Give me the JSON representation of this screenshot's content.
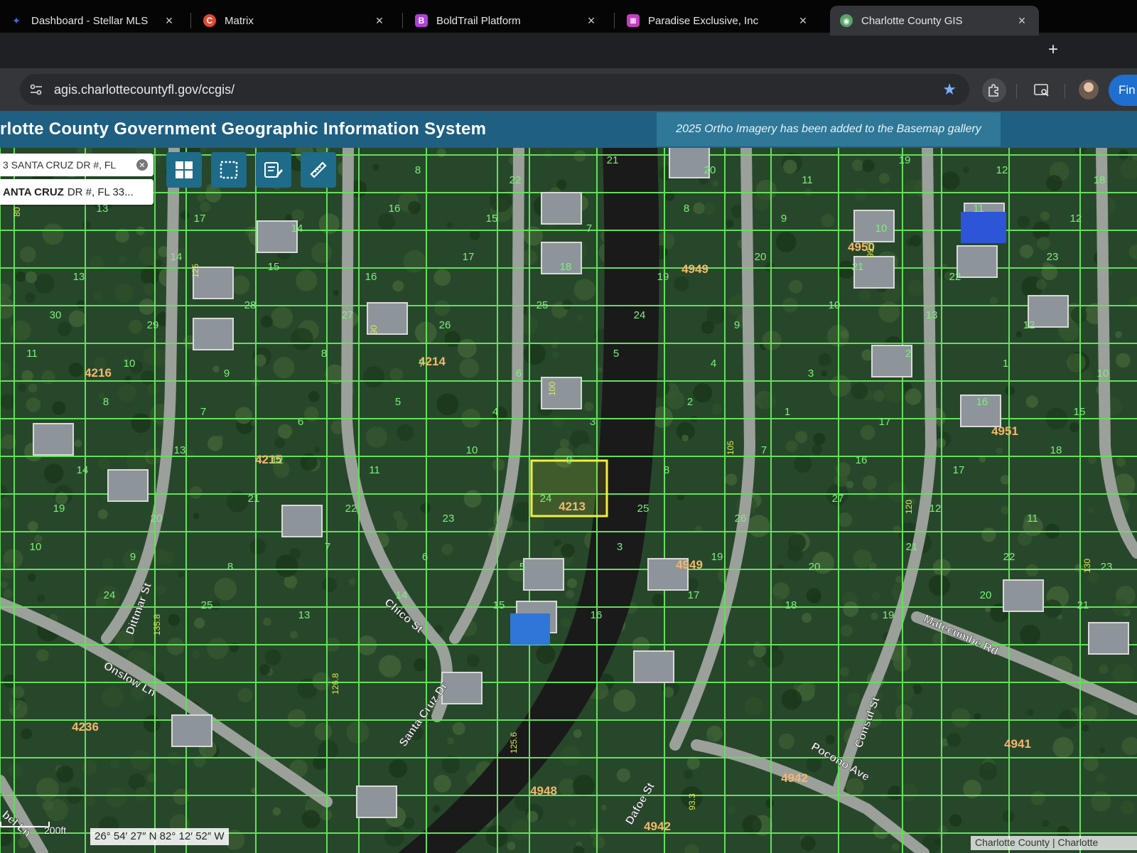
{
  "browser": {
    "tabs": [
      {
        "title": "Dashboard - Stellar MLS",
        "favicon_color": "#3a6fd8"
      },
      {
        "title": "Matrix",
        "favicon_color": "#e0492f"
      },
      {
        "title": "BoldTrail Platform",
        "favicon_color": "#b13fd6"
      },
      {
        "title": "Paradise Exclusive, Inc",
        "favicon_color": "#c23fbf"
      },
      {
        "title": "Charlotte County GIS",
        "favicon_color": "#5aa36b"
      }
    ],
    "favicon_letters": {
      "matrix": "C",
      "boldtrail": "B"
    },
    "close_glyph": "×",
    "new_tab_glyph": "+",
    "url": "agis.charlottecountyfl.gov/ccgis/",
    "find_label": "Fin"
  },
  "gis": {
    "title": "rlotte County Government Geographic Information System",
    "banner": "2025 Ortho Imagery has been added to the Basemap gallery",
    "search_value": "3 SANTA CRUZ DR #, FL",
    "suggestion_bold": "ANTA CRUZ",
    "suggestion_rest": "DR #, FL 33...",
    "tools": [
      "grid-tool",
      "select-tool",
      "notes-tool",
      "measure-tool"
    ]
  },
  "map": {
    "street_labels": [
      {
        "text": "Dittmar St"
      },
      {
        "text": "Onslow Ln"
      },
      {
        "text": "Chico St"
      },
      {
        "text": "Santa Cruz Dr"
      },
      {
        "text": "Dafoe St"
      },
      {
        "text": "Pocono Ave"
      },
      {
        "text": "Consul St"
      },
      {
        "text": "Matecumbe Rd"
      },
      {
        "text": "bel Ln"
      }
    ],
    "block_numbers": [
      "4216",
      "4214",
      "4215",
      "4213",
      "4236",
      "4949",
      "4950",
      "4951",
      "4948",
      "4942",
      "4941",
      "4949",
      "4942"
    ],
    "lot_numbers": [
      "6",
      "24",
      "7",
      "23",
      "8",
      "22",
      "21",
      "20",
      "11",
      "19",
      "12",
      "18",
      "13",
      "17",
      "14",
      "16",
      "15",
      "7",
      "8",
      "9",
      "10",
      "11",
      "12",
      "13",
      "14",
      "15",
      "16",
      "17",
      "18",
      "19",
      "20",
      "21",
      "22",
      "23",
      "30",
      "29",
      "28",
      "27",
      "26",
      "25",
      "24",
      "9",
      "10",
      "13",
      "12",
      "11",
      "10",
      "9",
      "8",
      "7",
      "6",
      "5",
      "4",
      "3",
      "2",
      "1",
      "10",
      "8",
      "7",
      "6",
      "5",
      "4",
      "3",
      "2",
      "1",
      "17",
      "16",
      "15",
      "14",
      "13",
      "12",
      "11",
      "10",
      "9",
      "8",
      "7",
      "16",
      "17",
      "18",
      "19",
      "20",
      "21",
      "22",
      "23",
      "24",
      "25",
      "26",
      "27",
      "12",
      "11",
      "10",
      "9",
      "8",
      "7",
      "6",
      "5",
      "3",
      "19",
      "20",
      "21",
      "22",
      "23",
      "24",
      "25",
      "13",
      "14",
      "15",
      "16",
      "17",
      "18",
      "19",
      "20",
      "21"
    ],
    "dimension_labels": [
      "80",
      "125",
      "90",
      "100",
      "105",
      "120",
      "130",
      "135.8",
      "126.8",
      "125.6",
      "93.3",
      "99.7"
    ],
    "scale_label": "200ft",
    "coordinates": "26° 54′ 27″ N 82° 12′ 52″ W",
    "attribution": "Charlotte County | Charlotte"
  },
  "colors": {
    "parcel_line": "#63e05a",
    "selected_parcel": "#f3ef3c",
    "canal": "#1a1a1a",
    "header": "#1f5f82",
    "banner": "#2f7897",
    "block_label": "#f6b76d",
    "lot_label": "#7cf07a",
    "star": "#7bb0ff"
  }
}
